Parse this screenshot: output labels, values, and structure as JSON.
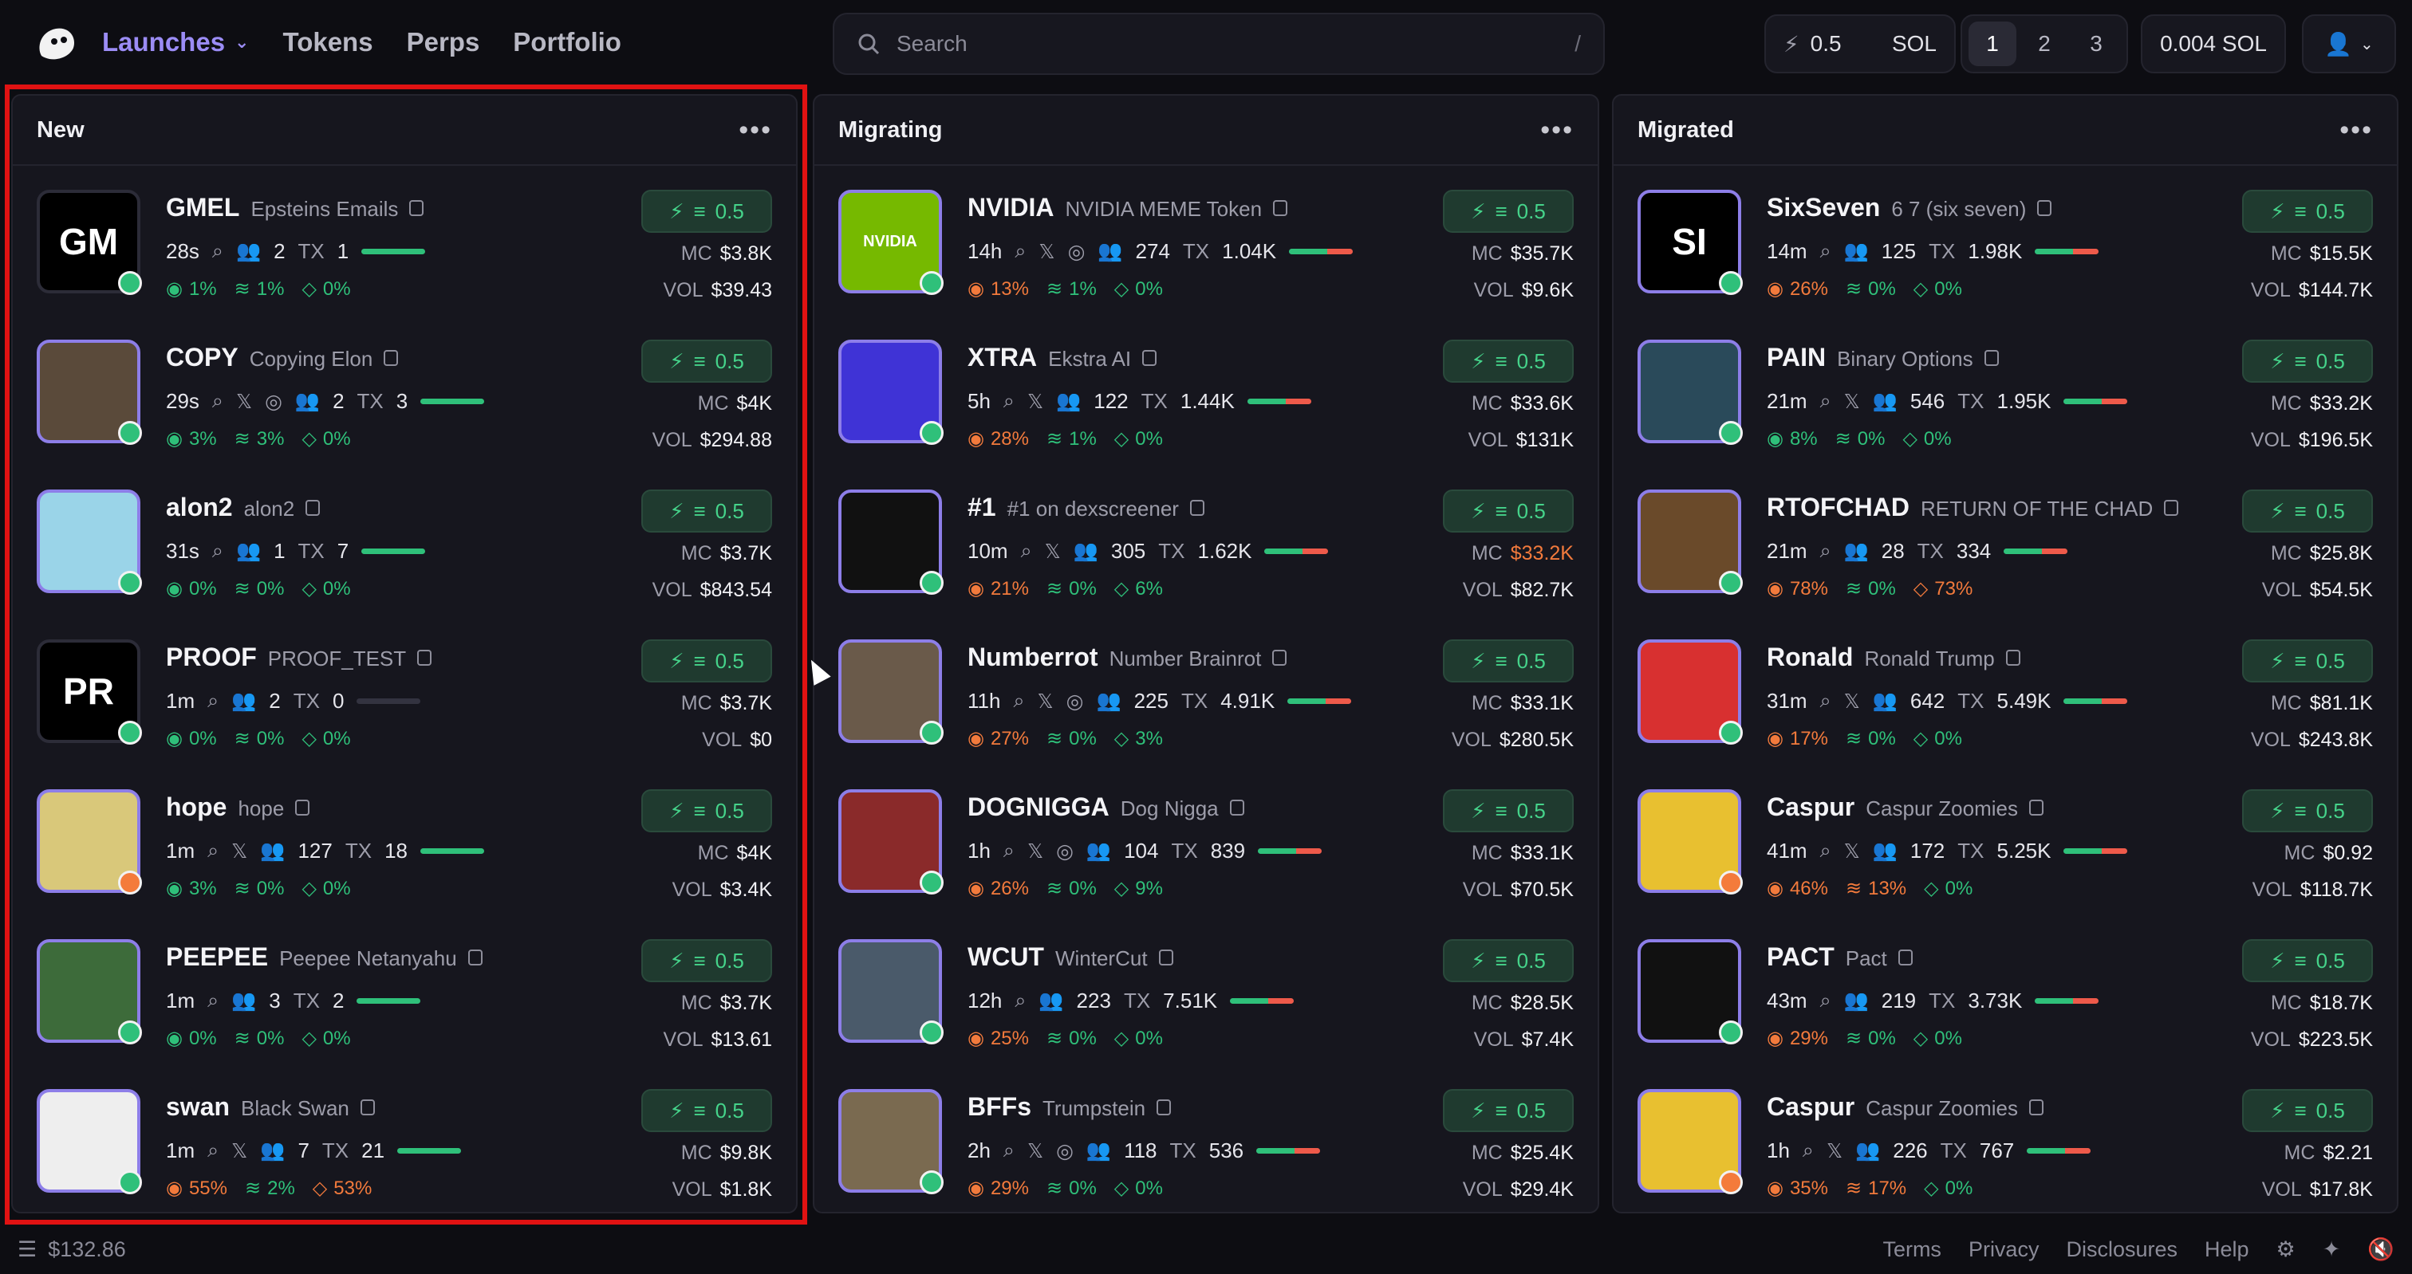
{
  "nav": {
    "launches": "Launches",
    "tokens": "Tokens",
    "perps": "Perps",
    "portfolio": "Portfolio"
  },
  "search": {
    "placeholder": "Search",
    "shortcut": "/"
  },
  "quickbuy": {
    "amount": "0.5",
    "unit": "SOL"
  },
  "presets": [
    "1",
    "2",
    "3"
  ],
  "balance": "0.004 SOL",
  "columns": [
    {
      "title": "New",
      "tokens": [
        {
          "ticker": "GMEL",
          "name": "Epsteins Emails",
          "initials": "GM",
          "age": "28s",
          "holders": "2",
          "tx": "1",
          "mc": "$3.8K",
          "vol": "$39.43",
          "s1": "1%",
          "s2": "1%",
          "s3": "0%",
          "buy": "0.5"
        },
        {
          "ticker": "COPY",
          "name": "Copying Elon",
          "initials": "",
          "age": "29s",
          "holders": "2",
          "tx": "3",
          "mc": "$4K",
          "vol": "$294.88",
          "s1": "3%",
          "s2": "3%",
          "s3": "0%",
          "buy": "0.5"
        },
        {
          "ticker": "alon2",
          "name": "alon2",
          "initials": "",
          "age": "31s",
          "holders": "1",
          "tx": "7",
          "mc": "$3.7K",
          "vol": "$843.54",
          "s1": "0%",
          "s2": "0%",
          "s3": "0%",
          "buy": "0.5"
        },
        {
          "ticker": "PROOF",
          "name": "PROOF_TEST",
          "initials": "PR",
          "age": "1m",
          "holders": "2",
          "tx": "0",
          "mc": "$3.7K",
          "vol": "$0",
          "s1": "0%",
          "s2": "0%",
          "s3": "0%",
          "buy": "0.5"
        },
        {
          "ticker": "hope",
          "name": "hope",
          "initials": "",
          "age": "1m",
          "holders": "127",
          "tx": "18",
          "mc": "$4K",
          "vol": "$3.4K",
          "s1": "3%",
          "s2": "0%",
          "s3": "0%",
          "buy": "0.5"
        },
        {
          "ticker": "PEEPEE",
          "name": "Peepee Netanyahu",
          "initials": "",
          "age": "1m",
          "holders": "3",
          "tx": "2",
          "mc": "$3.7K",
          "vol": "$13.61",
          "s1": "0%",
          "s2": "0%",
          "s3": "0%",
          "buy": "0.5"
        },
        {
          "ticker": "swan",
          "name": "Black Swan",
          "initials": "",
          "age": "1m",
          "holders": "7",
          "tx": "21",
          "mc": "$9.8K",
          "vol": "$1.8K",
          "s1": "55%",
          "s2": "2%",
          "s3": "53%",
          "buy": "0.5"
        }
      ]
    },
    {
      "title": "Migrating",
      "tokens": [
        {
          "ticker": "NVIDIA",
          "name": "NVIDIA MEME Token",
          "initials": "NVIDIA",
          "age": "14h",
          "holders": "274",
          "tx": "1.04K",
          "mc": "$35.7K",
          "vol": "$9.6K",
          "s1": "13%",
          "s2": "1%",
          "s3": "0%",
          "buy": "0.5"
        },
        {
          "ticker": "XTRA",
          "name": "Ekstra AI",
          "initials": "",
          "age": "5h",
          "holders": "122",
          "tx": "1.44K",
          "mc": "$33.6K",
          "vol": "$131K",
          "s1": "28%",
          "s2": "1%",
          "s3": "0%",
          "buy": "0.5"
        },
        {
          "ticker": "#1",
          "name": "#1 on dexscreener",
          "initials": "",
          "age": "10m",
          "holders": "305",
          "tx": "1.62K",
          "mc": "$33.2K",
          "vol": "$82.7K",
          "s1": "21%",
          "s2": "0%",
          "s3": "6%",
          "buy": "0.5"
        },
        {
          "ticker": "Numberrot",
          "name": "Number Brainrot",
          "initials": "",
          "age": "11h",
          "holders": "225",
          "tx": "4.91K",
          "mc": "$33.1K",
          "vol": "$280.5K",
          "s1": "27%",
          "s2": "0%",
          "s3": "3%",
          "buy": "0.5"
        },
        {
          "ticker": "DOGNIGGA",
          "name": "Dog Nigga",
          "initials": "",
          "age": "1h",
          "holders": "104",
          "tx": "839",
          "mc": "$33.1K",
          "vol": "$70.5K",
          "s1": "26%",
          "s2": "0%",
          "s3": "9%",
          "buy": "0.5"
        },
        {
          "ticker": "WCUT",
          "name": "WinterCut",
          "initials": "",
          "age": "12h",
          "holders": "223",
          "tx": "7.51K",
          "mc": "$28.5K",
          "vol": "$7.4K",
          "s1": "25%",
          "s2": "0%",
          "s3": "0%",
          "buy": "0.5"
        },
        {
          "ticker": "BFFs",
          "name": "Trumpstein",
          "initials": "",
          "age": "2h",
          "holders": "118",
          "tx": "536",
          "mc": "$25.4K",
          "vol": "$29.4K",
          "s1": "29%",
          "s2": "0%",
          "s3": "0%",
          "buy": "0.5"
        }
      ]
    },
    {
      "title": "Migrated",
      "tokens": [
        {
          "ticker": "SixSeven",
          "name": "6 7 (six seven)",
          "initials": "SI",
          "age": "14m",
          "holders": "125",
          "tx": "1.98K",
          "mc": "$15.5K",
          "vol": "$144.7K",
          "s1": "26%",
          "s2": "0%",
          "s3": "0%",
          "buy": "0.5"
        },
        {
          "ticker": "PAIN",
          "name": "Binary Options",
          "initials": "",
          "age": "21m",
          "holders": "546",
          "tx": "1.95K",
          "mc": "$33.2K",
          "vol": "$196.5K",
          "s1": "8%",
          "s2": "0%",
          "s3": "0%",
          "buy": "0.5"
        },
        {
          "ticker": "RTOFCHAD",
          "name": "RETURN OF THE CHAD",
          "initials": "",
          "age": "21m",
          "holders": "28",
          "tx": "334",
          "mc": "$25.8K",
          "vol": "$54.5K",
          "s1": "78%",
          "s2": "0%",
          "s3": "73%",
          "buy": "0.5"
        },
        {
          "ticker": "Ronald",
          "name": "Ronald Trump",
          "initials": "",
          "age": "31m",
          "holders": "642",
          "tx": "5.49K",
          "mc": "$81.1K",
          "vol": "$243.8K",
          "s1": "17%",
          "s2": "0%",
          "s3": "0%",
          "buy": "0.5"
        },
        {
          "ticker": "Caspur",
          "name": "Caspur Zoomies",
          "initials": "",
          "age": "41m",
          "holders": "172",
          "tx": "5.25K",
          "mc": "$0.92",
          "vol": "$118.7K",
          "s1": "46%",
          "s2": "13%",
          "s3": "0%",
          "buy": "0.5"
        },
        {
          "ticker": "PACT",
          "name": "Pact",
          "initials": "",
          "age": "43m",
          "holders": "219",
          "tx": "3.73K",
          "mc": "$18.7K",
          "vol": "$223.5K",
          "s1": "29%",
          "s2": "0%",
          "s3": "0%",
          "buy": "0.5"
        },
        {
          "ticker": "Caspur",
          "name": "Caspur Zoomies",
          "initials": "",
          "age": "1h",
          "holders": "226",
          "tx": "767",
          "mc": "$2.21",
          "vol": "$17.8K",
          "s1": "35%",
          "s2": "17%",
          "s3": "0%",
          "buy": "0.5"
        }
      ]
    }
  ],
  "footer": {
    "wallet": "$132.86",
    "terms": "Terms",
    "privacy": "Privacy",
    "disclosures": "Disclosures",
    "help": "Help"
  },
  "labels": {
    "mc": "MC",
    "vol": "VOL",
    "tx": "TX"
  },
  "colors": {
    "accent": "#9b8cf5",
    "positive": "#2fc07a",
    "negative": "#f27a3c",
    "highlight": "#e01212"
  }
}
